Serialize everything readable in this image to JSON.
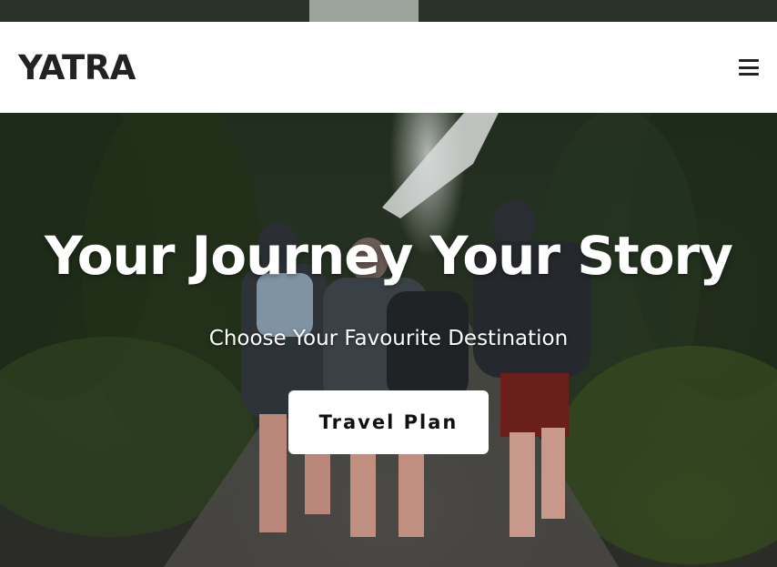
{
  "brand": {
    "name": "YATRA"
  },
  "nav": {
    "menu_icon": "hamburger-menu-icon"
  },
  "hero": {
    "title": "Your Journey Your Story",
    "subtitle": "Choose Your Favourite Destination",
    "cta_label": "Travel Plan",
    "background": "hikers-walking-forest-path-photo"
  },
  "colors": {
    "navbar_bg": "#ffffff",
    "brand_text": "#222222",
    "hero_text": "#ffffff",
    "button_bg": "#ffffff",
    "button_text": "#111111"
  }
}
